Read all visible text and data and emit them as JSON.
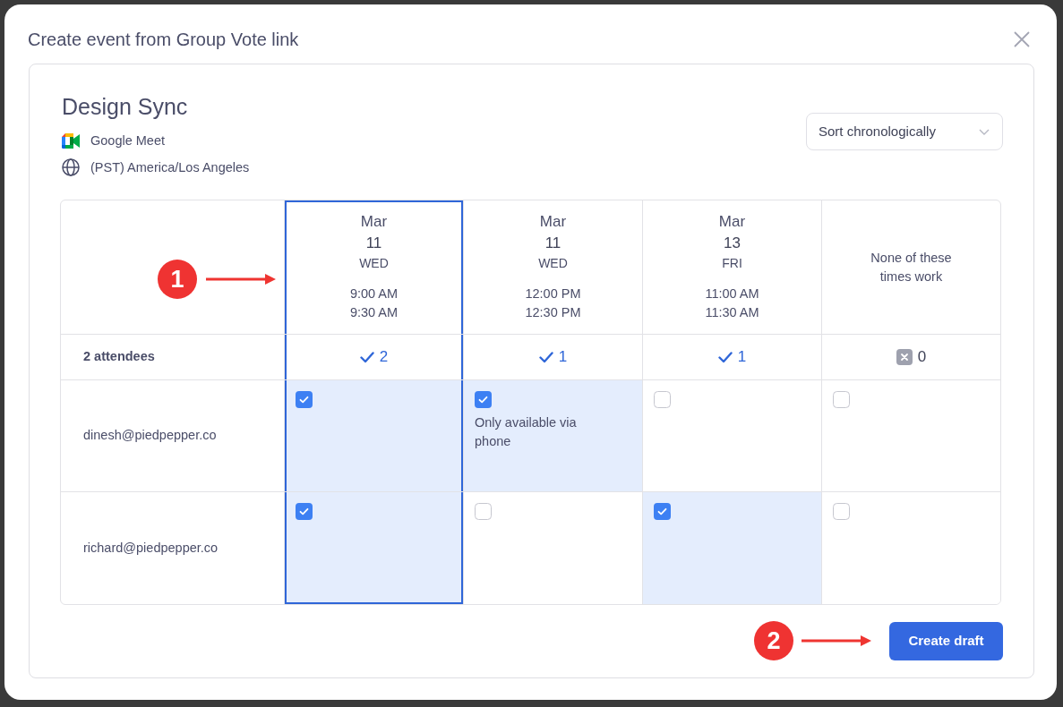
{
  "dialog": {
    "title": "Create event from Group Vote link"
  },
  "event": {
    "title": "Design Sync",
    "conferencing": "Google Meet",
    "timezone": "(PST) America/Los Angeles"
  },
  "sort_dropdown": {
    "value": "Sort chronologically"
  },
  "table": {
    "attendee_summary": "2 attendees",
    "columns": [
      {
        "kind": "slot",
        "month": "Mar",
        "day": "11",
        "weekday": "WED",
        "start": "9:00 AM",
        "end": "9:30 AM",
        "count": "2",
        "selected": true
      },
      {
        "kind": "slot",
        "month": "Mar",
        "day": "11",
        "weekday": "WED",
        "start": "12:00 PM",
        "end": "12:30 PM",
        "count": "1",
        "selected": false
      },
      {
        "kind": "slot",
        "month": "Mar",
        "day": "13",
        "weekday": "FRI",
        "start": "11:00 AM",
        "end": "11:30 AM",
        "count": "1",
        "selected": false
      },
      {
        "kind": "none",
        "label": "None of these times work",
        "count": "0",
        "selected": false
      }
    ],
    "rows": [
      {
        "email": "dinesh@piedpepper.co",
        "cells": [
          {
            "checked": true
          },
          {
            "checked": true,
            "note": "Only available via phone"
          },
          {
            "checked": false
          },
          {
            "checked": false
          }
        ]
      },
      {
        "email": "richard@piedpepper.co",
        "cells": [
          {
            "checked": true
          },
          {
            "checked": false
          },
          {
            "checked": true
          },
          {
            "checked": false
          }
        ]
      }
    ]
  },
  "annotations": [
    {
      "label": "1"
    },
    {
      "label": "2"
    }
  ],
  "primary_button": {
    "label": "Create draft"
  }
}
